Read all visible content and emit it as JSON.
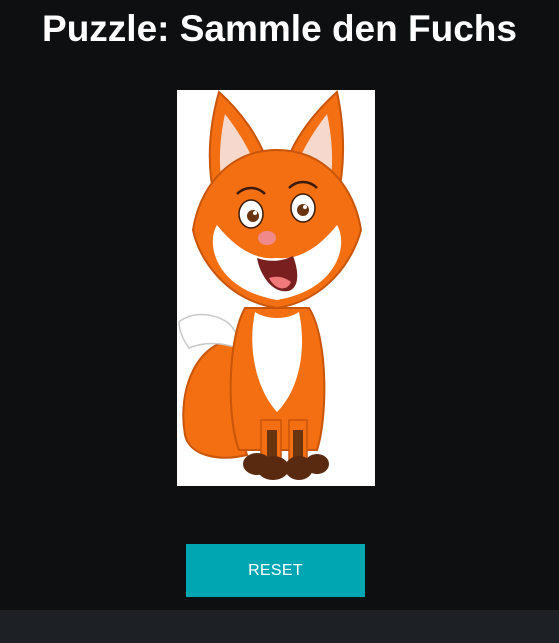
{
  "title": "Puzzle: Sammle den Fuchs",
  "puzzle": {
    "image_subject": "fox-cartoon"
  },
  "controls": {
    "reset_label": "RESET"
  },
  "colors": {
    "background": "#0d0f11",
    "button": "#00a6b2",
    "footer": "#1d2125",
    "fox_orange": "#f36f12",
    "fox_dark": "#5a2a10"
  }
}
